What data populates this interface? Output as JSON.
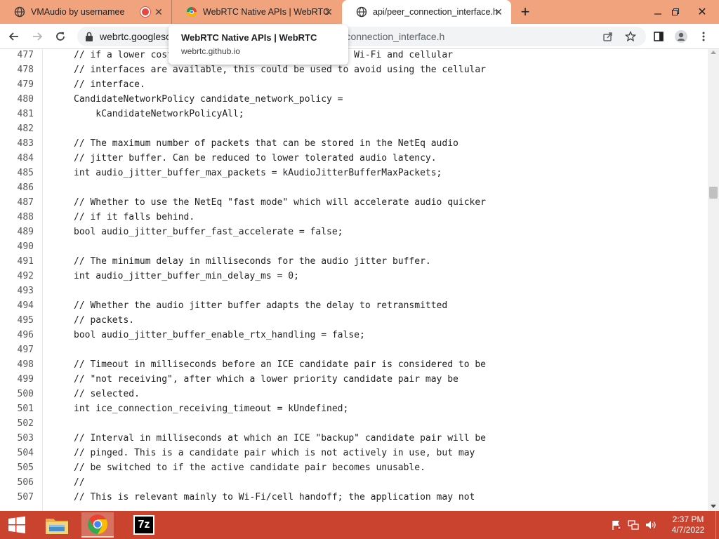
{
  "browser": {
    "tabs": [
      {
        "title": "VMAudio by usernamee",
        "active": false,
        "recording": true
      },
      {
        "title": "WebRTC Native APIs | WebRTC",
        "active": false
      },
      {
        "title": "api/peer_connection_interface.h",
        "active": true
      }
    ],
    "address": {
      "url_prefix": "webrtc.googlesc",
      "url_suffix": "r_connection_interface.h"
    },
    "tooltip": {
      "title": "WebRTC Native APIs | WebRTC",
      "domain": "webrtc.github.io"
    }
  },
  "code_view": {
    "lines": [
      {
        "n": "477",
        "text": "// if a lower cost network is available, e.g. both Wi-Fi and cellular"
      },
      {
        "n": "478",
        "text": "// interfaces are available, this could be used to avoid using the cellular"
      },
      {
        "n": "479",
        "text": "// interface."
      },
      {
        "n": "480",
        "text": "CandidateNetworkPolicy candidate_network_policy ="
      },
      {
        "n": "481",
        "text": "    kCandidateNetworkPolicyAll;"
      },
      {
        "n": "482",
        "text": ""
      },
      {
        "n": "483",
        "text": "// The maximum number of packets that can be stored in the NetEq audio"
      },
      {
        "n": "484",
        "text": "// jitter buffer. Can be reduced to lower tolerated audio latency."
      },
      {
        "n": "485",
        "text": "int audio_jitter_buffer_max_packets = kAudioJitterBufferMaxPackets;"
      },
      {
        "n": "486",
        "text": ""
      },
      {
        "n": "487",
        "text": "// Whether to use the NetEq \"fast mode\" which will accelerate audio quicker"
      },
      {
        "n": "488",
        "text": "// if it falls behind."
      },
      {
        "n": "489",
        "text": "bool audio_jitter_buffer_fast_accelerate = false;"
      },
      {
        "n": "490",
        "text": ""
      },
      {
        "n": "491",
        "text": "// The minimum delay in milliseconds for the audio jitter buffer."
      },
      {
        "n": "492",
        "text": "int audio_jitter_buffer_min_delay_ms = 0;"
      },
      {
        "n": "493",
        "text": ""
      },
      {
        "n": "494",
        "text": "// Whether the audio jitter buffer adapts the delay to retransmitted"
      },
      {
        "n": "495",
        "text": "// packets."
      },
      {
        "n": "496",
        "text": "bool audio_jitter_buffer_enable_rtx_handling = false;"
      },
      {
        "n": "497",
        "text": ""
      },
      {
        "n": "498",
        "text": "// Timeout in milliseconds before an ICE candidate pair is considered to be"
      },
      {
        "n": "499",
        "text": "// \"not receiving\", after which a lower priority candidate pair may be"
      },
      {
        "n": "500",
        "text": "// selected."
      },
      {
        "n": "501",
        "text": "int ice_connection_receiving_timeout = kUndefined;"
      },
      {
        "n": "502",
        "text": ""
      },
      {
        "n": "503",
        "text": "// Interval in milliseconds at which an ICE \"backup\" candidate pair will be"
      },
      {
        "n": "504",
        "text": "// pinged. This is a candidate pair which is not actively in use, but may"
      },
      {
        "n": "505",
        "text": "// be switched to if the active candidate pair becomes unusable."
      },
      {
        "n": "506",
        "text": "//"
      },
      {
        "n": "507",
        "text": "// This is relevant mainly to Wi-Fi/cell handoff; the application may not"
      }
    ],
    "scroll_position_fraction": 0.3
  },
  "taskbar": {
    "apps": [
      "file-explorer",
      "chrome",
      "7-zip"
    ],
    "seven_zip_label": "7z",
    "clock_time": "2:37 PM",
    "clock_date": "4/7/2022"
  },
  "colors": {
    "tabstrip": "#f0a37c",
    "taskbar": "#c9432e",
    "recording": "#e8453c"
  }
}
